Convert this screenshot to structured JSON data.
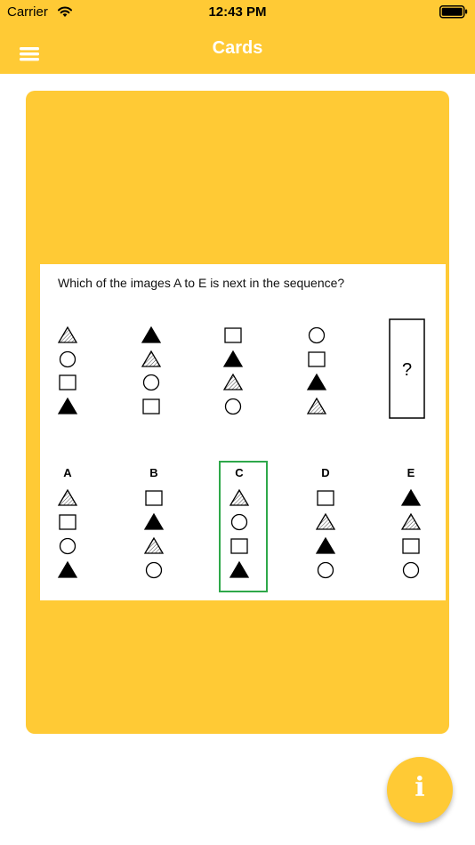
{
  "status_bar": {
    "carrier": "Carrier",
    "time": "12:43 PM"
  },
  "nav": {
    "title": "Cards",
    "menu_icon": "hamburger-menu-icon"
  },
  "card": {
    "question": "Which of the images A to E is next in the sequence?",
    "missing_symbol": "?",
    "sequence": [
      [
        "triangle-hatched",
        "circle",
        "square",
        "triangle-filled"
      ],
      [
        "triangle-filled",
        "triangle-hatched",
        "circle",
        "square"
      ],
      [
        "square",
        "triangle-filled",
        "triangle-hatched",
        "circle"
      ],
      [
        "circle",
        "square",
        "triangle-filled",
        "triangle-hatched"
      ]
    ],
    "options": [
      {
        "label": "A",
        "shapes": [
          "triangle-hatched",
          "square",
          "circle",
          "triangle-filled"
        ]
      },
      {
        "label": "B",
        "shapes": [
          "square",
          "triangle-filled",
          "triangle-hatched",
          "circle"
        ]
      },
      {
        "label": "C",
        "shapes": [
          "triangle-hatched",
          "circle",
          "square",
          "triangle-filled"
        ]
      },
      {
        "label": "D",
        "shapes": [
          "square",
          "triangle-hatched",
          "triangle-filled",
          "circle"
        ]
      },
      {
        "label": "E",
        "shapes": [
          "triangle-filled",
          "triangle-hatched",
          "square",
          "circle"
        ]
      }
    ],
    "highlighted_option": "C"
  },
  "info_button": {
    "glyph": "i",
    "icon": "info-icon"
  },
  "colors": {
    "accent": "#FFCA35",
    "highlight": "#2EA84A"
  }
}
